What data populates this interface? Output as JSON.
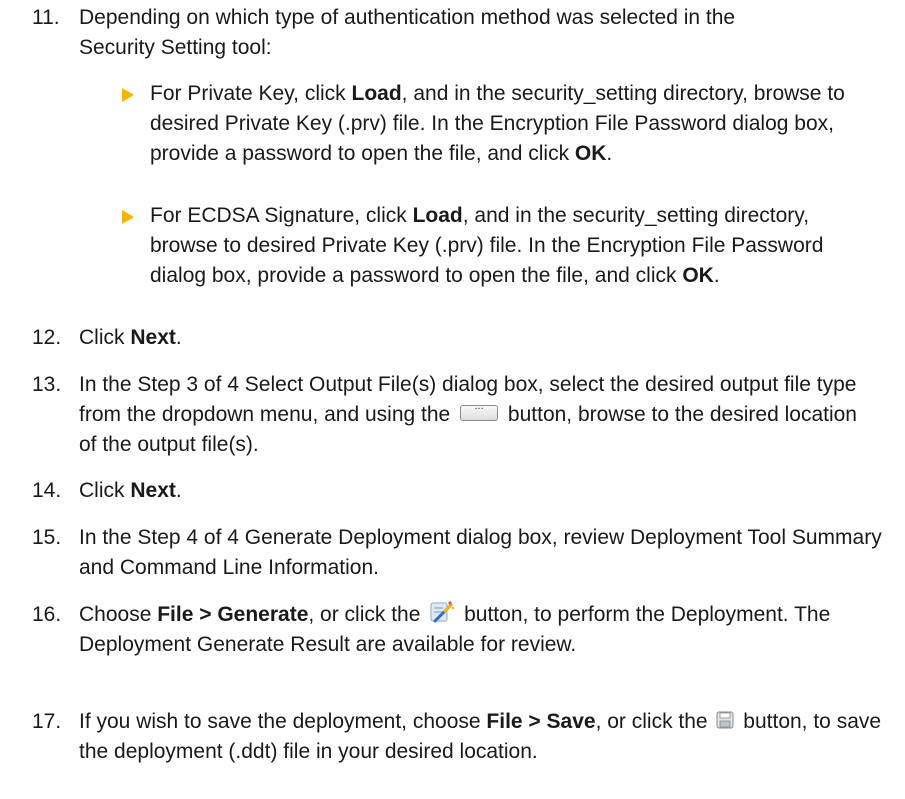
{
  "steps": [
    {
      "num": "11.",
      "line1": "Depending on which type of authentication method was selected in the",
      "line2": "Security Setting tool:",
      "bullets": [
        {
          "pre": "For Private Key, click ",
          "bold": "Load",
          "mid": ", and in the security_setting directory, browse to desired Private Key (.prv) file. In the Encryption File Password dialog box, provide a password to open the file, and click ",
          "bold2": "OK",
          "post": "."
        },
        {
          "pre": "For ECDSA Signature, click ",
          "bold": "Load",
          "mid": ", and in the security_setting directory, browse to desired Private Key (.prv) file. In the Encryption File Password dialog box, provide a password to open the file, and click ",
          "bold2": "OK",
          "post": "."
        }
      ]
    },
    {
      "num": "12.",
      "pre": "Click ",
      "bold": "Next",
      "post": "."
    },
    {
      "num": "13.",
      "pre": "In the Step 3 of 4 Select Output File(s) dialog box, select the desired output file type from the dropdown menu, and using the",
      "post": "button, browse to the desired location of the output file(s)."
    },
    {
      "num": "14.",
      "pre": "Click ",
      "bold": "Next",
      "post": "."
    },
    {
      "num": "15.",
      "text": "In the Step 4 of 4 Generate Deployment dialog box, review Deployment Tool Summary and Command Line Information."
    },
    {
      "num": "16.",
      "pre": "Choose ",
      "bold": "File > Generate",
      "mid": ", or click the",
      "post": "button, to perform the Deployment. The Deployment Generate Result are available for review."
    },
    {
      "num": "17.",
      "pre": "If you wish to save the deployment, choose ",
      "bold": "File > Save",
      "mid": ", or click the",
      "post": "button, to save the deployment (.ddt) file in your desired location."
    }
  ],
  "icons": {
    "bullet": "triangle-bullet-icon",
    "browse": "ellipsis-browse-button-icon",
    "generate": "generate-wand-icon",
    "save": "floppy-save-icon"
  },
  "colors": {
    "bullet": "#f5b400",
    "text": "#1a1a1a"
  }
}
